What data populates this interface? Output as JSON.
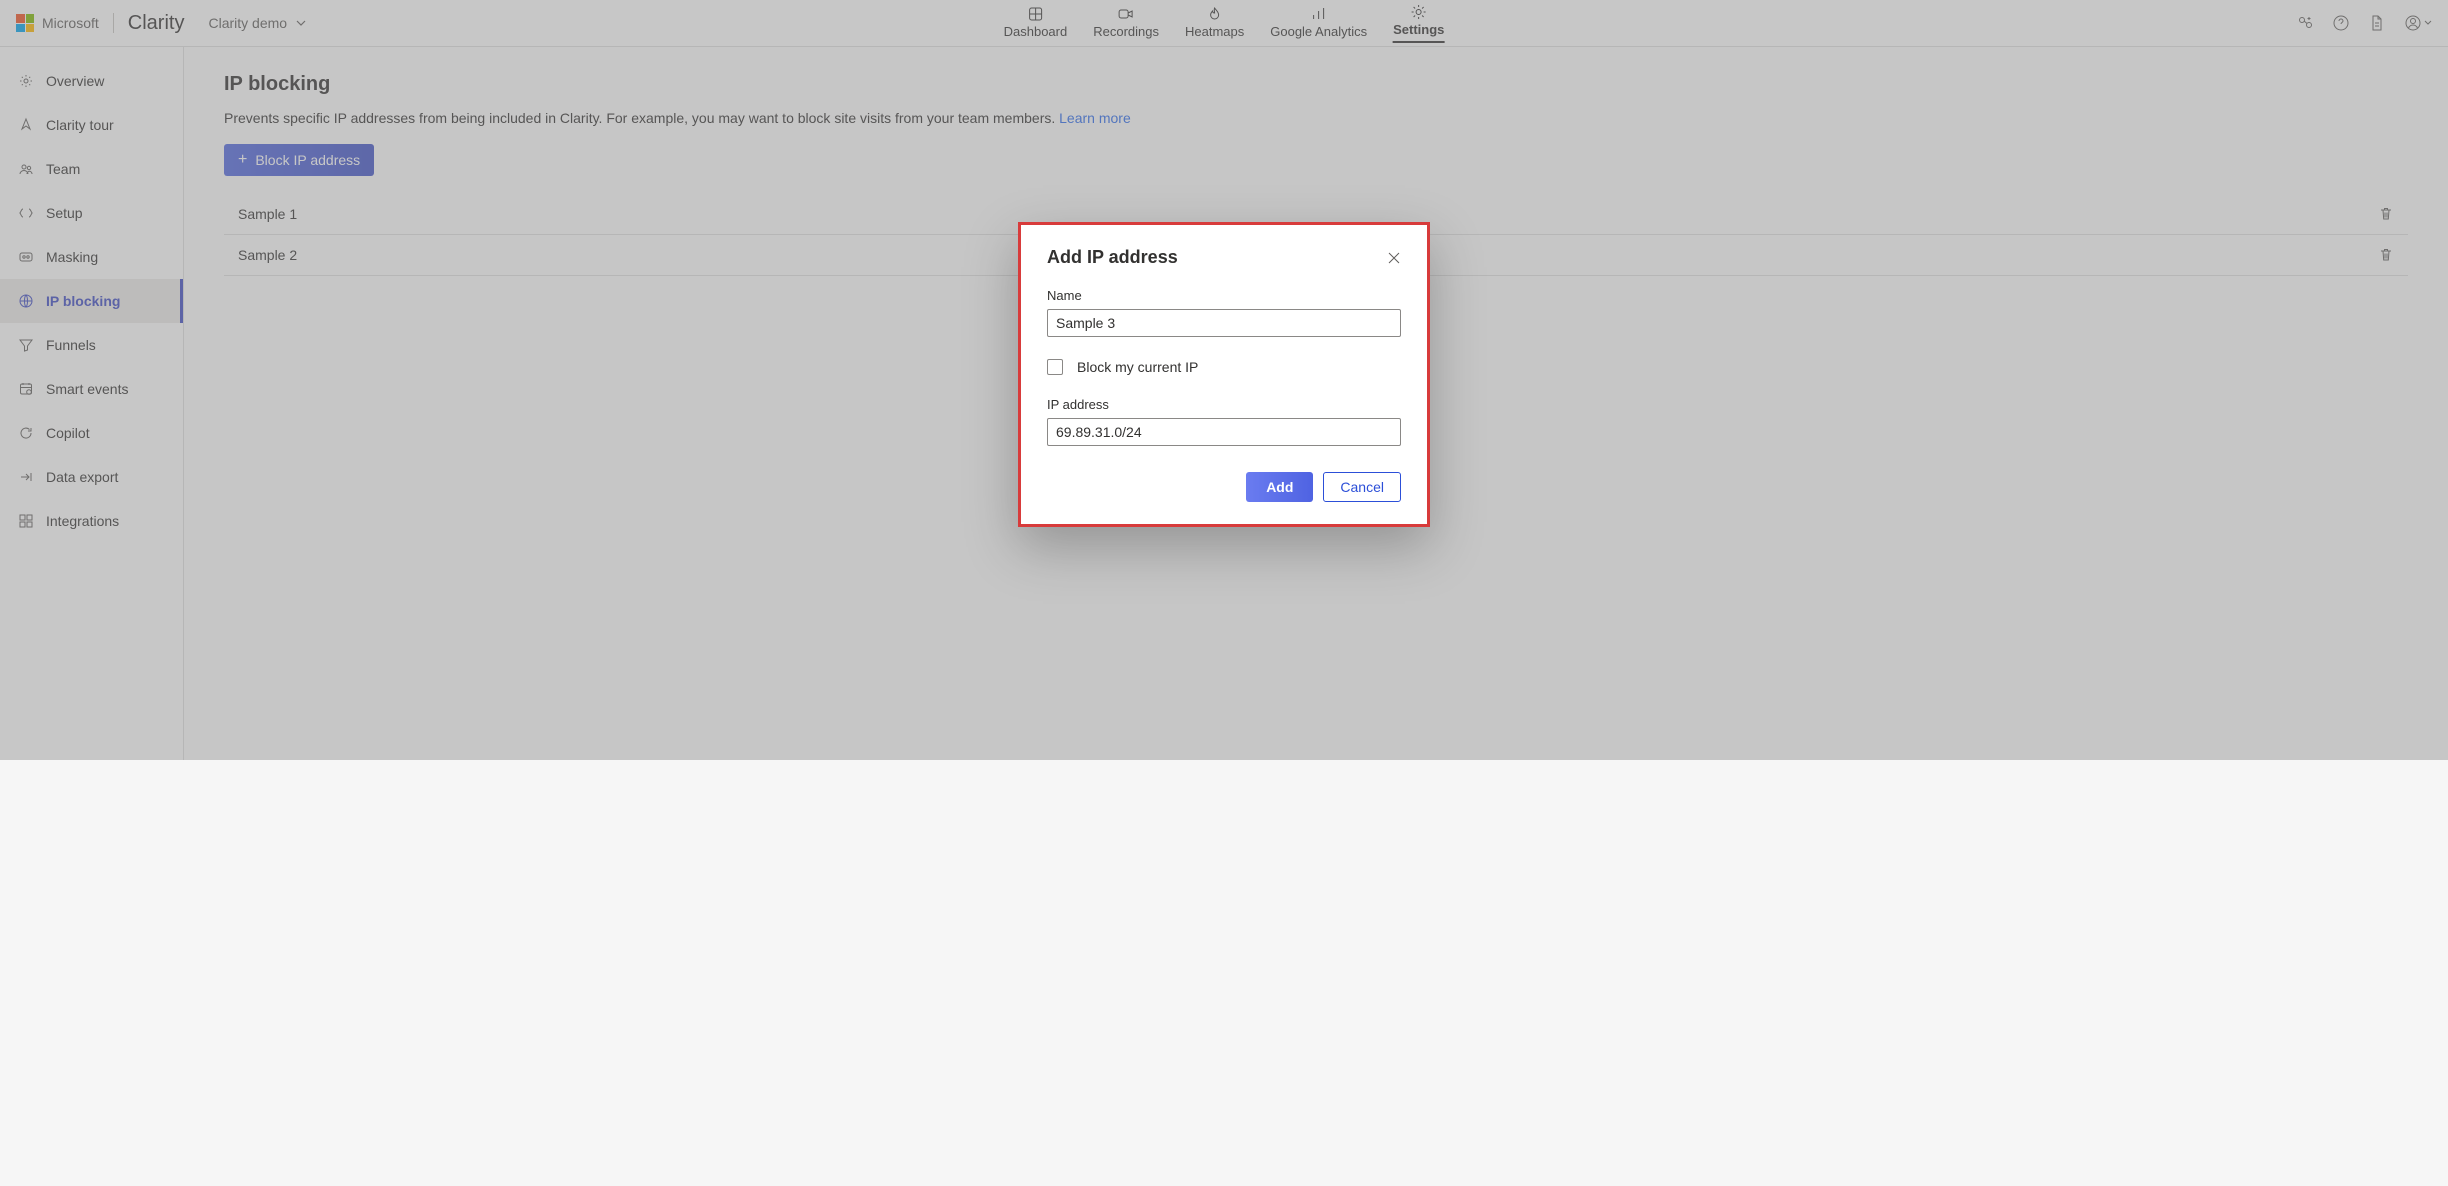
{
  "header": {
    "company": "Microsoft",
    "product": "Clarity",
    "project": "Clarity demo",
    "tabs": [
      {
        "id": "dashboard",
        "label": "Dashboard"
      },
      {
        "id": "recordings",
        "label": "Recordings"
      },
      {
        "id": "heatmaps",
        "label": "Heatmaps"
      },
      {
        "id": "ga",
        "label": "Google Analytics"
      },
      {
        "id": "settings",
        "label": "Settings"
      }
    ],
    "active_tab": "settings"
  },
  "sidebar": {
    "items": [
      {
        "id": "overview",
        "label": "Overview"
      },
      {
        "id": "tour",
        "label": "Clarity tour"
      },
      {
        "id": "team",
        "label": "Team"
      },
      {
        "id": "setup",
        "label": "Setup"
      },
      {
        "id": "masking",
        "label": "Masking"
      },
      {
        "id": "ipblocking",
        "label": "IP blocking"
      },
      {
        "id": "funnels",
        "label": "Funnels"
      },
      {
        "id": "smartevents",
        "label": "Smart events"
      },
      {
        "id": "copilot",
        "label": "Copilot"
      },
      {
        "id": "dataexport",
        "label": "Data export"
      },
      {
        "id": "integrations",
        "label": "Integrations"
      }
    ],
    "active": "ipblocking"
  },
  "page": {
    "title": "IP blocking",
    "description": "Prevents specific IP addresses from being included in Clarity. For example, you may want to block site visits from your team members. ",
    "learn_more": "Learn more",
    "block_button": "Block IP address",
    "rows": [
      {
        "name": "Sample 1"
      },
      {
        "name": "Sample 2"
      }
    ]
  },
  "modal": {
    "title": "Add IP address",
    "name_label": "Name",
    "name_value": "Sample 3",
    "block_current_label": "Block my current IP",
    "block_current_checked": false,
    "ip_label": "IP address",
    "ip_value": "69.89.31.0/24",
    "add_label": "Add",
    "cancel_label": "Cancel"
  }
}
